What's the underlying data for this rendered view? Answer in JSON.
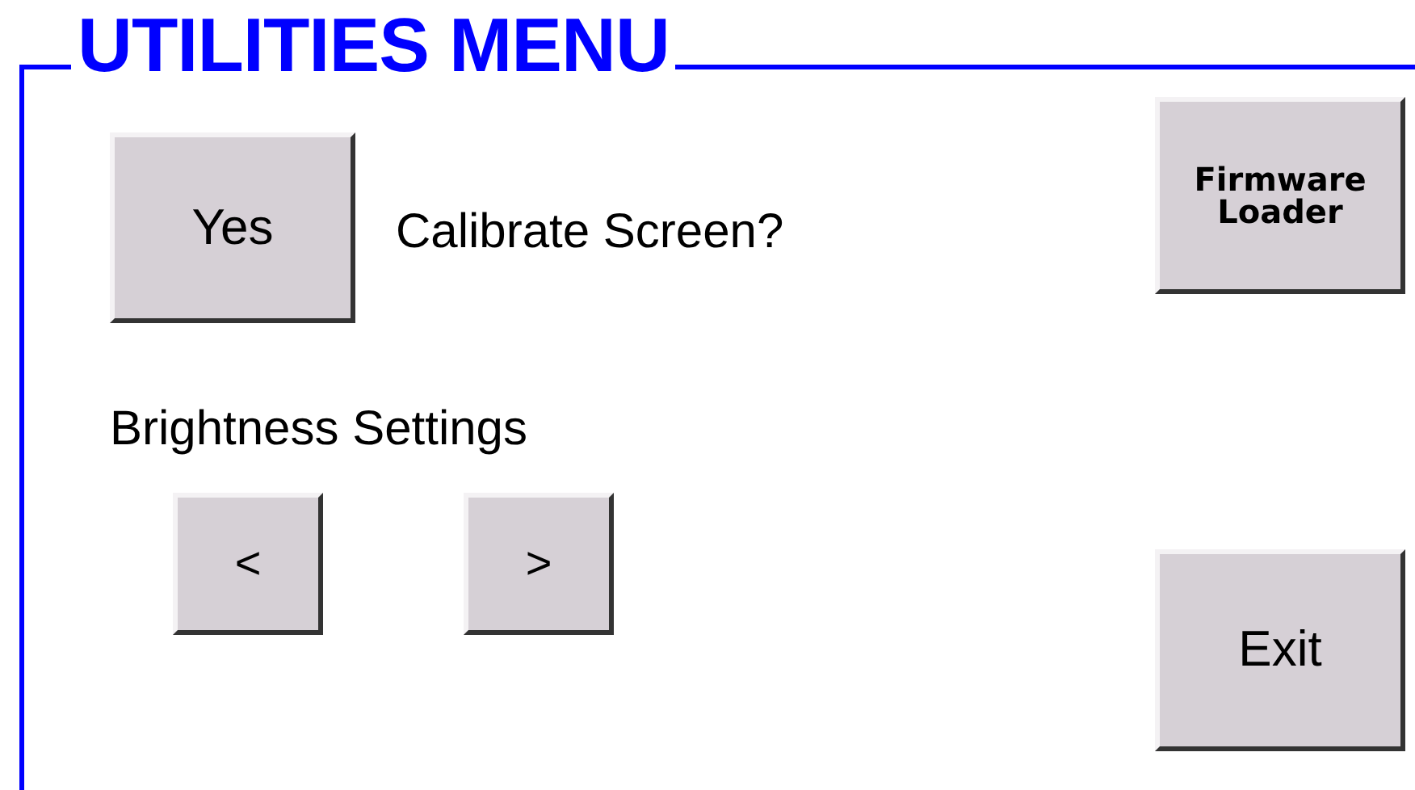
{
  "title": "UTILITIES MENU",
  "calibrate": {
    "button": "Yes",
    "question": "Calibrate Screen?"
  },
  "firmware_button": "Firmware Loader",
  "brightness": {
    "label": "Brightness Settings",
    "buttons": [
      "<",
      ">"
    ]
  },
  "exit_button": "Exit"
}
